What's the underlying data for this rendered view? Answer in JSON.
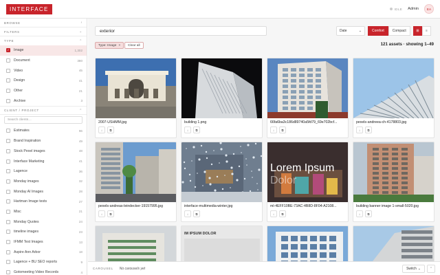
{
  "header": {
    "logo": "INTERFACE",
    "status": "IDLE",
    "user": "Admin",
    "avatar_initials": "EA"
  },
  "sidebar": {
    "browse_label": "BROWSE",
    "filters_label": "FILTERS",
    "type_label": "TYPE",
    "types": [
      {
        "label": "Image",
        "count": "1,302",
        "checked": true
      },
      {
        "label": "Document",
        "count": "380",
        "checked": false
      },
      {
        "label": "Video",
        "count": "45",
        "checked": false
      },
      {
        "label": "Design",
        "count": "41",
        "checked": false
      },
      {
        "label": "Other",
        "count": "21",
        "checked": false
      },
      {
        "label": "Archive",
        "count": "3",
        "checked": false
      }
    ],
    "client_label": "CLIENT / PROJECT",
    "client_search_placeholder": "Search clients…",
    "clients": [
      {
        "label": "Estimates",
        "count": "96"
      },
      {
        "label": "Brand Inspiration",
        "count": "49"
      },
      {
        "label": "Stock Pexel images",
        "count": "48"
      },
      {
        "label": "Interface Marketing",
        "count": "41"
      },
      {
        "label": "Lagence",
        "count": "36"
      },
      {
        "label": "Monday images",
        "count": "32"
      },
      {
        "label": "Monday AI Images",
        "count": "28"
      },
      {
        "label": "Hartman Image tests",
        "count": "27"
      },
      {
        "label": "Misc",
        "count": "21"
      },
      {
        "label": "Monday Quotes",
        "count": "24"
      },
      {
        "label": "timeline images",
        "count": "23"
      },
      {
        "label": "IFMM Test Images",
        "count": "13"
      },
      {
        "label": "Aspire Ann Arbor",
        "count": "18"
      },
      {
        "label": "Lagence + BU SEO reports",
        "count": "9"
      },
      {
        "label": "Gotomeeting Video Records",
        "count": "4"
      }
    ]
  },
  "toolbar": {
    "search_value": "exterior",
    "sort_value": "Date",
    "density_comfort": "Comfort",
    "density_compact": "Compact",
    "filter_chip": "Type: Image",
    "clear_all": "Clear all",
    "asset_count": "121 assets · showing 1–49"
  },
  "assets": [
    {
      "name": "2007-USHMM.jpg",
      "thumb": "museum"
    },
    {
      "name": "building 1.png",
      "thumb": "dark"
    },
    {
      "name": "66fa6ba3c186d89740a5fd79_69e702bcf...",
      "thumb": "apart"
    },
    {
      "name": "pexels-andreea-ch-4178803.jpg",
      "thumb": "sky"
    },
    {
      "name": "pexels-andreas-leindecker-19157995.jpg",
      "thumb": "street"
    },
    {
      "name": "interface-multimedia-winter.jpg",
      "thumb": "winter"
    },
    {
      "name": "ml-4EFF10BE-73AC-4B8D-8F04-A2108...",
      "thumb": "lorem"
    },
    {
      "name": "building banner image 1-small-5020.jpg",
      "thumb": "tower"
    },
    {
      "name": "",
      "thumb": "row3a"
    },
    {
      "name": "",
      "thumb": "row3b"
    },
    {
      "name": "",
      "thumb": "row3c"
    },
    {
      "name": "",
      "thumb": "row3d"
    }
  ],
  "lorem_text": "Lorem Ipsum Dolor",
  "row3b_text": "IM IPSUM DOLOR",
  "carousel": {
    "label": "CAROUSEL",
    "empty": "No carousels yet",
    "switch": "Switch"
  }
}
